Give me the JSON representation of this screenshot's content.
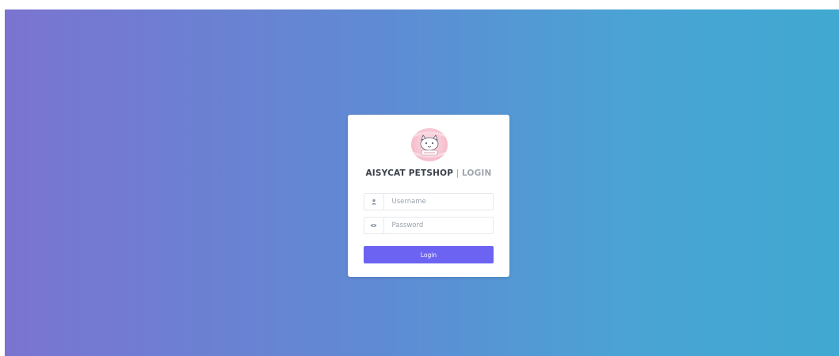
{
  "login": {
    "brand_name": "AISYCAT PETSHOP",
    "separator": "|",
    "subtitle": "LOGIN",
    "username_placeholder": "Username",
    "password_placeholder": "Password",
    "login_button": "Login"
  },
  "icons": {
    "username": "user-icon",
    "password": "eye-icon",
    "logo": "cat-logo"
  },
  "colors": {
    "gradient_start": "#7a74d0",
    "gradient_end": "#40a9d1",
    "button": "#6c63f2",
    "card": "#ffffff"
  }
}
